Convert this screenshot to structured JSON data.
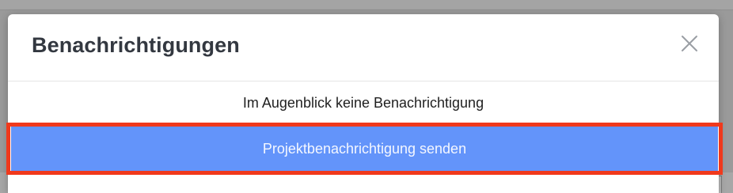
{
  "modal": {
    "title": "Benachrichtigungen",
    "close_icon": "close-icon",
    "message": "Im Augenblick keine Benachrichtigung",
    "send_button_label": "Projektbenachrichtigung senden"
  },
  "colors": {
    "button_background": "#6394fa",
    "highlight_border": "#f0391c",
    "title_text": "#333840"
  }
}
